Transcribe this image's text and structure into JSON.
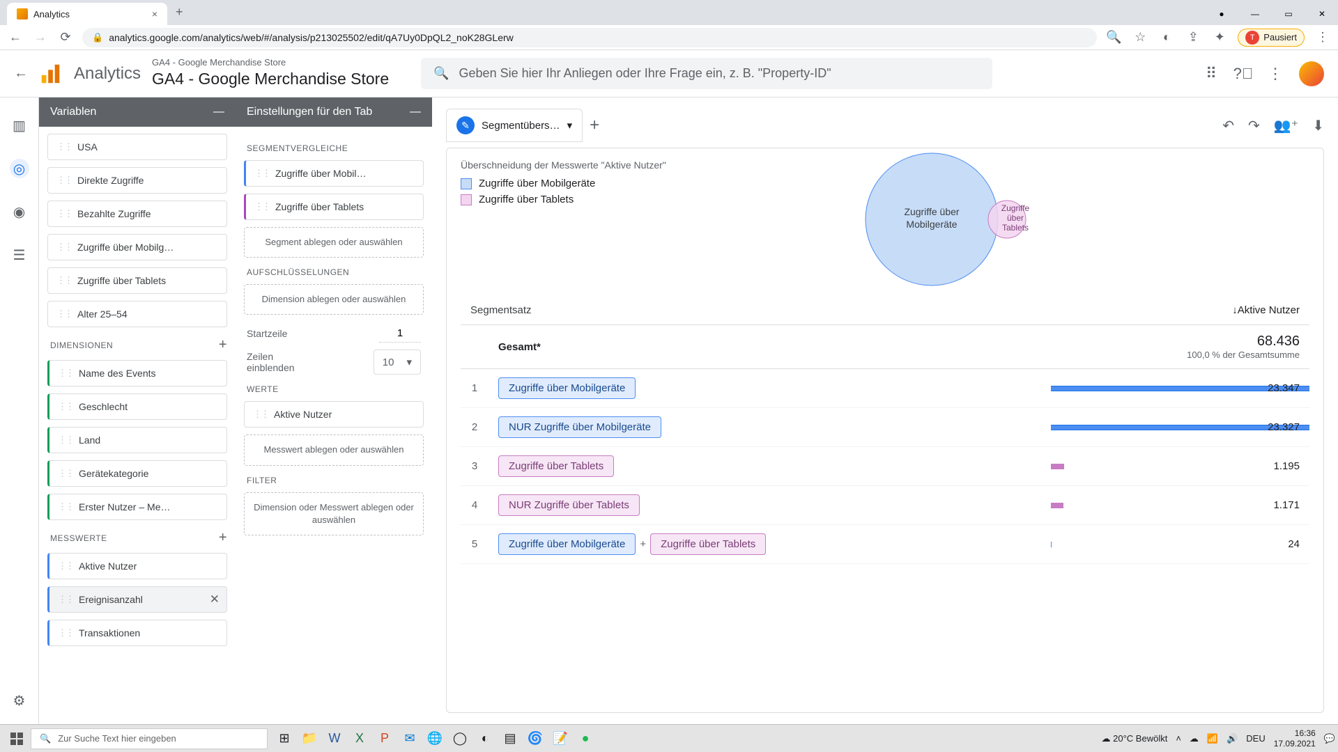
{
  "browser": {
    "tab_title": "Analytics",
    "url": "analytics.google.com/analytics/web/#/analysis/p213025502/edit/qA7Uy0DpQL2_noK28GLerw",
    "profile_status": "Pausiert"
  },
  "header": {
    "app_name": "Analytics",
    "property_line": "GA4 - Google Merchandise Store",
    "property_name": "GA4 - Google Merchandise Store",
    "search_placeholder": "Geben Sie hier Ihr Anliegen oder Ihre Frage ein, z. B. \"Property-ID\""
  },
  "variablen": {
    "title": "Variablen",
    "segments": [
      "USA",
      "Direkte Zugriffe",
      "Bezahlte Zugriffe",
      "Zugriffe über Mobilg…",
      "Zugriffe über Tablets",
      "Alter 25–54"
    ],
    "dimensionen_title": "DIMENSIONEN",
    "dimensionen": [
      "Name des Events",
      "Geschlecht",
      "Land",
      "Gerätekategorie",
      "Erster Nutzer – Me…"
    ],
    "messwerte_title": "MESSWERTE",
    "messwerte": [
      "Aktive Nutzer",
      "Ereignisanzahl",
      "Transaktionen"
    ]
  },
  "settings": {
    "title": "Einstellungen für den Tab",
    "segvergleiche_title": "SEGMENTVERGLEICHE",
    "seg_chips": [
      "Zugriffe über Mobil…",
      "Zugriffe über Tablets"
    ],
    "seg_dropzone": "Segment ablegen oder auswählen",
    "aufschl_title": "AUFSCHLÜSSELUNGEN",
    "dim_dropzone": "Dimension ablegen oder auswählen",
    "startzeile_label": "Startzeile",
    "startzeile_value": "1",
    "zeilen_label": "Zeilen einblenden",
    "zeilen_value": "10",
    "werte_title": "WERTE",
    "werte_chip": "Aktive Nutzer",
    "werte_dropzone": "Messwert ablegen oder auswählen",
    "filter_title": "FILTER",
    "filter_dropzone": "Dimension oder Messwert ablegen oder auswählen"
  },
  "explore": {
    "tab_name": "Segmentübers…",
    "subtitle": "Überschneidung der Messwerte \"Aktive Nutzer\"",
    "legend1": "Zugriffe über Mobilgeräte",
    "legend2": "Zugriffe über Tablets",
    "venn_label1": "Zugriffe über Mobilgeräte",
    "venn_label2": "Zugriffe über Tablets",
    "col_seg": "Segmentsatz",
    "col_val": "↓Aktive Nutzer",
    "gesamt": "Gesamt*",
    "gesamt_val": "68.436",
    "gesamt_sub": "100,0 % der Gesamtsumme",
    "rows": [
      {
        "idx": "1",
        "pills": [
          {
            "text": "Zugriffe über Mobilgeräte",
            "cls": "pill-blue"
          }
        ],
        "val": "23.347",
        "bar": 100,
        "barcls": "blue"
      },
      {
        "idx": "2",
        "pills": [
          {
            "text": "NUR Zugriffe über Mobilgeräte",
            "cls": "pill-blue"
          }
        ],
        "val": "23.327",
        "bar": 99.9,
        "barcls": "blue"
      },
      {
        "idx": "3",
        "pills": [
          {
            "text": "Zugriffe über Tablets",
            "cls": "pill-pink"
          }
        ],
        "val": "1.195",
        "bar": 5.1,
        "barcls": "pink"
      },
      {
        "idx": "4",
        "pills": [
          {
            "text": "NUR Zugriffe über Tablets",
            "cls": "pill-pink"
          }
        ],
        "val": "1.171",
        "bar": 5.0,
        "barcls": "pink"
      },
      {
        "idx": "5",
        "pills": [
          {
            "text": "Zugriffe über Mobilgeräte",
            "cls": "pill-blue"
          },
          {
            "text": "Zugriffe über Tablets",
            "cls": "pill-pink"
          }
        ],
        "val": "24",
        "bar": 0.1,
        "barcls": "blue"
      }
    ]
  },
  "taskbar": {
    "search_placeholder": "Zur Suche Text hier eingeben",
    "weather": "20°C  Bewölkt",
    "lang": "DEU",
    "time": "16:36",
    "date": "17.09.2021"
  },
  "chart_data": {
    "type": "table",
    "title": "Überschneidung der Messwerte \"Aktive Nutzer\"",
    "ylabel": "Aktive Nutzer",
    "total": 68436,
    "series": [
      {
        "name": "Zugriffe über Mobilgeräte",
        "value": 23347
      },
      {
        "name": "NUR Zugriffe über Mobilgeräte",
        "value": 23327
      },
      {
        "name": "Zugriffe über Tablets",
        "value": 1195
      },
      {
        "name": "NUR Zugriffe über Tablets",
        "value": 1171
      },
      {
        "name": "Zugriffe über Mobilgeräte + Zugriffe über Tablets",
        "value": 24
      }
    ],
    "venn": {
      "sets": [
        "Zugriffe über Mobilgeräte",
        "Zugriffe über Tablets"
      ],
      "sizes": [
        23347,
        1195
      ],
      "intersection": 24
    }
  }
}
